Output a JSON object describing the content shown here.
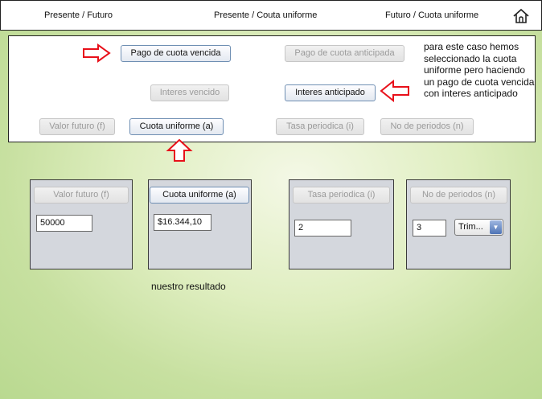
{
  "nav": {
    "tab_present_future": "Presente / Futuro",
    "tab_present_uniform": "Presente / Couta uniforme",
    "tab_future_uniform": "Futuro / Cuota uniforme",
    "home_icon": "home-icon"
  },
  "options": {
    "due_payment": "Pago de cuota vencida",
    "advance_payment": "Pago de cuota anticipada",
    "due_interest": "Interes vencido",
    "advance_interest": "Interes anticipado",
    "future_value": "Valor futuro (f)",
    "uniform_payment": "Cuota uniforme (a)",
    "periodic_rate": "Tasa periodica (i)",
    "num_periods": "No de periodos (n)"
  },
  "note": "para este caso hemos seleccionado la cuota uniforme pero haciendo un pago de cuota vencida con interes anticipado",
  "calc": {
    "future_value": {
      "label": "Valor futuro (f)",
      "value": "50000"
    },
    "uniform_payment": {
      "label": "Cuota uniforme (a)",
      "value": "$16.344,10"
    },
    "periodic_rate": {
      "label": "Tasa periodica (i)",
      "value": "2"
    },
    "num_periods": {
      "label": "No de periodos (n)",
      "value": "3",
      "unit_selected": "Trim..."
    }
  },
  "caption": "nuestro resultado",
  "colors": {
    "arrow": "#e8101a",
    "card_bg": "#d4d7dd"
  }
}
